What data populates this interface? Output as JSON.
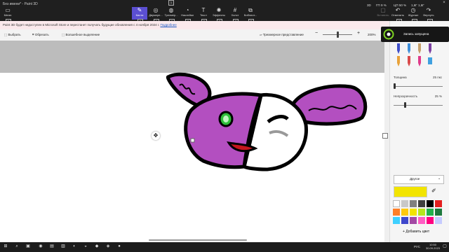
{
  "window": {
    "title": "Без имени* - Paint 3D",
    "menu_label": "Меню",
    "close_icon": "×"
  },
  "ribbon": {
    "tabs": [
      {
        "label": "Кисти",
        "icon": "brush-icon"
      },
      {
        "label": "Двумерн...",
        "icon": "2d-shapes-icon"
      },
      {
        "label": "Трехмер...",
        "icon": "3d-shapes-icon"
      },
      {
        "label": "Наклейки",
        "icon": "stickers-icon"
      },
      {
        "label": "Текст",
        "icon": "text-icon"
      },
      {
        "label": "Эффекты",
        "icon": "effects-icon"
      },
      {
        "label": "Холст",
        "icon": "canvas-icon"
      },
      {
        "label": "Библиот...",
        "icon": "library-icon"
      }
    ],
    "active_tab": "Кисти",
    "keytips": {
      "top": "1",
      "menu": "F",
      "tabs": [
        "B",
        "2",
        "3",
        "S",
        "T",
        "E",
        "C",
        "R"
      ],
      "right": [
        "Z",
        "H",
        "Y"
      ]
    },
    "status": {
      "mode": "3D",
      "gpu": "ГП",
      "gpu_val": "9 %",
      "cpu": "ЦП",
      "cpu_val": "50 %",
      "ram": "1,6Г",
      "ram2": "1,6Г"
    },
    "right_actions": [
      {
        "label": "Вставить",
        "icon": "paste-icon"
      },
      {
        "label": "Отменить",
        "icon": "undo-icon"
      },
      {
        "label": "Журнал",
        "icon": "history-icon"
      },
      {
        "label": "Вернуть",
        "icon": "redo-icon"
      }
    ],
    "accent": "#5b4fd1"
  },
  "notice": {
    "text": "Paint 3D будет недоступен в Microsoft Store и перестанет получать будущие обновления с 4 ноября 2024 г.",
    "link": "Подробнее"
  },
  "toolbar": {
    "select": "Выбрать",
    "crop": "Обрезать",
    "magic_select": "Волшебное выделение",
    "view_3d": "Трехмерное представление",
    "zoom_out": "−",
    "zoom_in": "+",
    "zoom": "200%",
    "zoom_level": 0.5
  },
  "panel": {
    "thickness_label": "Толщина",
    "thickness_value": "25 пкс",
    "thickness_level": 0.05,
    "opacity_label": "Непрозрачность",
    "opacity_value": "25 %",
    "opacity_level": 0.25,
    "color_mode": "Другое",
    "selected_color": "#f2e400",
    "add_color": "Добавить цвет",
    "colors": [
      "#ffffff",
      "#c8c8c8",
      "#7f7f7f",
      "#3f3f3f",
      "#000000",
      "#e41f1f",
      "#ff7f27",
      "#ffc90e",
      "#f2e400",
      "#b5e61d",
      "#22b14c",
      "#1f7a3f",
      "#3fd0ff",
      "#3f48cc",
      "#a349a4",
      "#ff5ec4",
      "#ff0080",
      "#c6cbff"
    ]
  },
  "recording": {
    "label": "Запись запущена"
  },
  "taskbar": {
    "language": "РУС",
    "time": "10:50",
    "date": "30.09.2023"
  }
}
